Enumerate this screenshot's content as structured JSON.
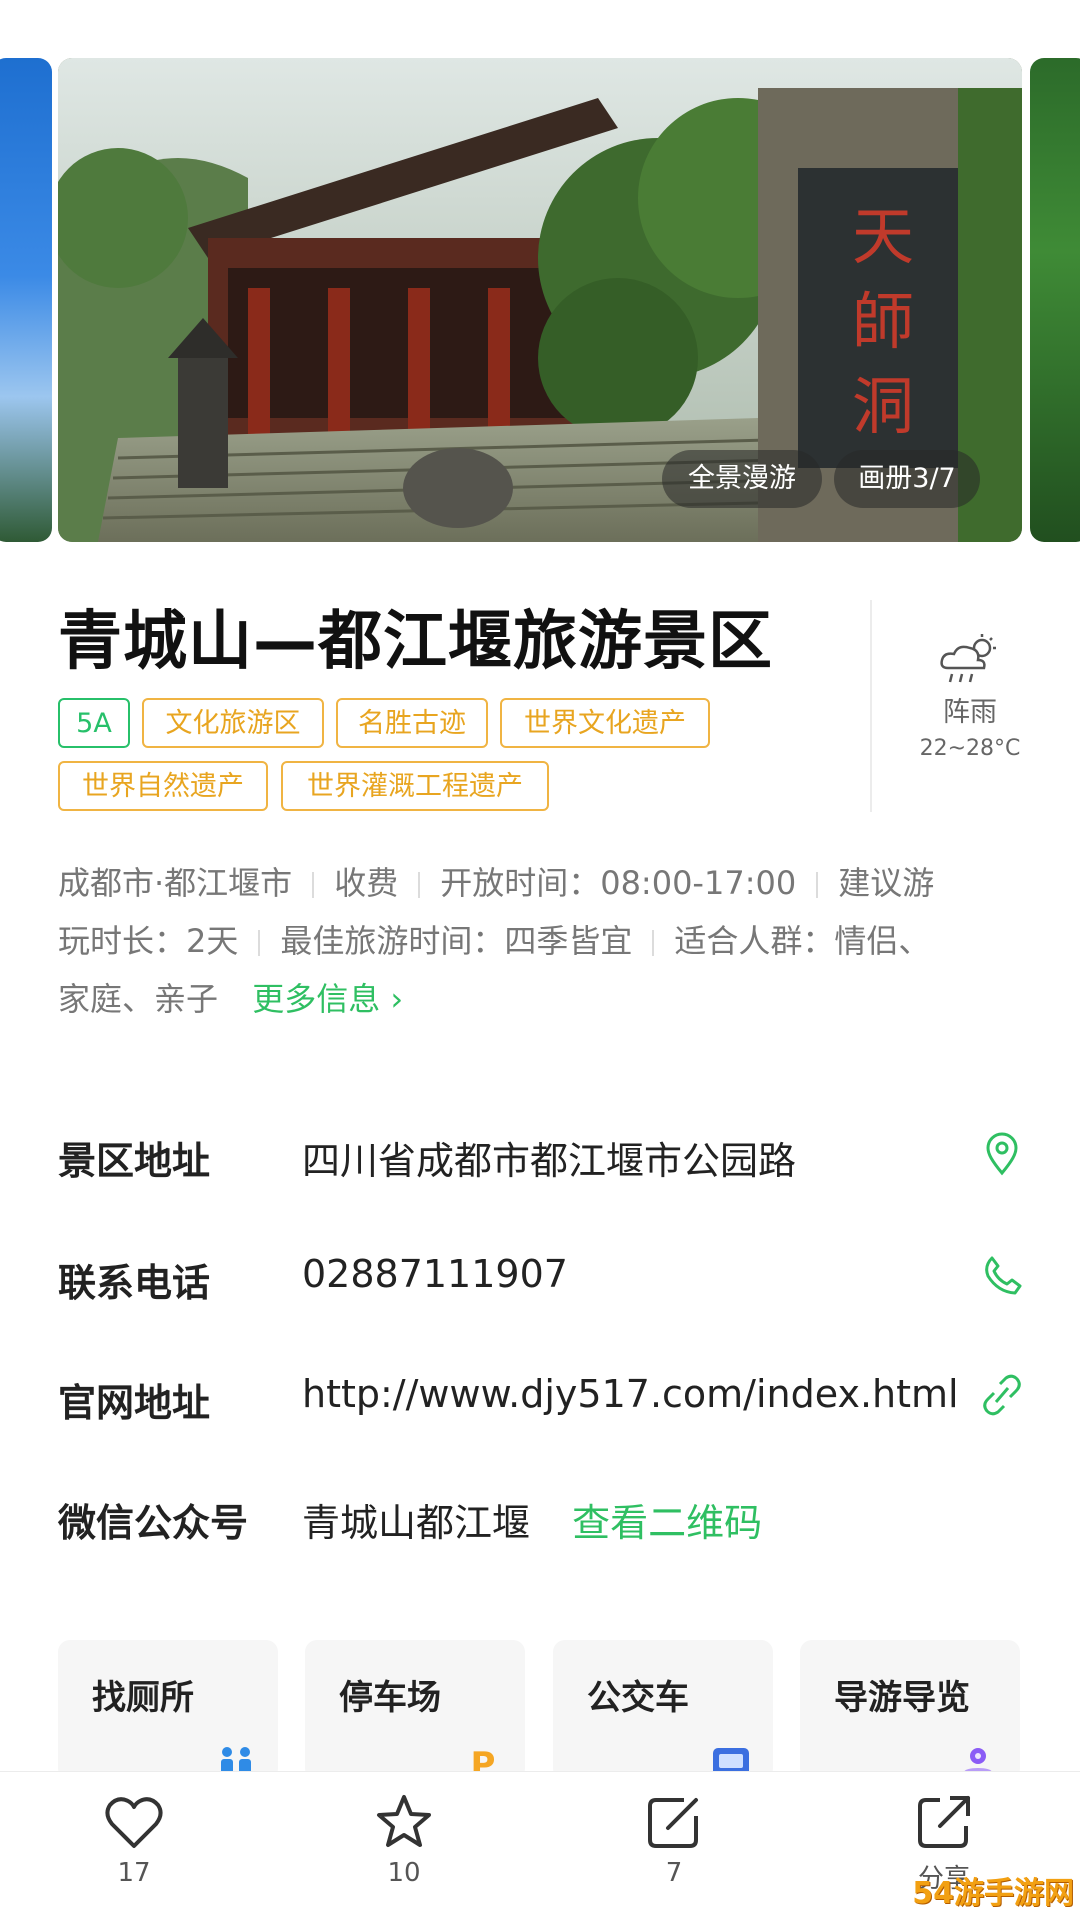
{
  "gallery": {
    "panorama_label": "全景漫游",
    "album_label": "画册3/7",
    "signboard_text": "天師洞"
  },
  "title": "青城山—都江堰旅游景区",
  "weather": {
    "condition": "阵雨",
    "temp": "22~28°C",
    "icon": "cloud-rain-sun-icon"
  },
  "tags": [
    {
      "label": "5A",
      "color": "#27c06a"
    },
    {
      "label": "文化旅游区",
      "color": "#e8a520"
    },
    {
      "label": "名胜古迹",
      "color": "#e8a520"
    },
    {
      "label": "世界文化遗产",
      "color": "#e8a520"
    },
    {
      "label": "世界自然遗产",
      "color": "#e8a520"
    },
    {
      "label": "世界灌溉工程遗产",
      "color": "#e8a520"
    }
  ],
  "info": {
    "location": "成都市·都江堰市",
    "fee": "收费",
    "open_hours": "开放时间：08:00-17:00",
    "duration_part1": "建议游",
    "duration_part2": "玩时长：2天",
    "best_time": "最佳旅游时间：四季皆宜",
    "crowd_part1": "适合人群：情侣、",
    "crowd_part2": "家庭、亲子",
    "more_link": "更多信息"
  },
  "details": {
    "address_label": "景区地址",
    "address": "四川省成都市都江堰市公园路",
    "phone_label": "联系电话",
    "phone": "02887111907",
    "website_label": "官网地址",
    "website": "http://www.djy517.com/index.html",
    "wechat_label": "微信公众号",
    "wechat": "青城山都江堰",
    "qr_link": "查看二维码"
  },
  "services": [
    {
      "label": "找厕所",
      "icon": "toilet-icon"
    },
    {
      "label": "停车场",
      "icon": "parking-icon"
    },
    {
      "label": "公交车",
      "icon": "bus-icon"
    },
    {
      "label": "导游导览",
      "icon": "guide-pin-icon"
    }
  ],
  "actions": {
    "like_count": "17",
    "favorite_count": "10",
    "comment_count": "7",
    "share_label": "分享"
  },
  "watermark": "54游手游网",
  "colors": {
    "accent_green": "#2fbf62",
    "tag_orange": "#e8a520"
  }
}
